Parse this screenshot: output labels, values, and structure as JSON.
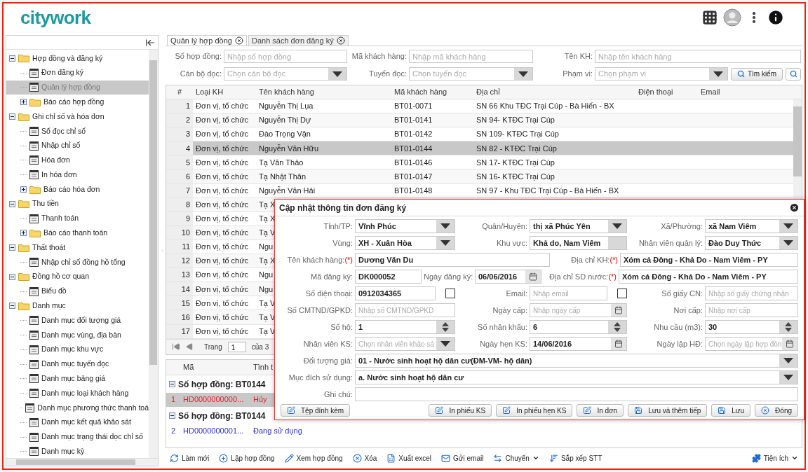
{
  "header": {
    "logo": "citywork"
  },
  "sidebar": {
    "items": [
      {
        "label": "Hợp đồng và đăng ký",
        "kind": "folder",
        "expanded": true,
        "selected": false,
        "children": [
          {
            "label": "Đơn đăng ký",
            "kind": "page",
            "selected": false
          },
          {
            "label": "Quản lý hợp đồng",
            "kind": "page",
            "selected": true
          },
          {
            "label": "Báo cáo hợp đồng",
            "kind": "folder",
            "expanded": false,
            "selected": false
          }
        ]
      },
      {
        "label": "Ghi chỉ số và hóa đơn",
        "kind": "folder",
        "expanded": true,
        "selected": false,
        "children": [
          {
            "label": "Sổ đọc chỉ số",
            "kind": "page",
            "selected": false
          },
          {
            "label": "Nhập chỉ số",
            "kind": "page",
            "selected": false
          },
          {
            "label": "Hóa đơn",
            "kind": "page",
            "selected": false
          },
          {
            "label": "In hóa đơn",
            "kind": "page",
            "selected": false
          },
          {
            "label": "Báo cáo hóa đơn",
            "kind": "folder",
            "expanded": false,
            "selected": false
          }
        ]
      },
      {
        "label": "Thu tiền",
        "kind": "folder",
        "expanded": true,
        "selected": false,
        "children": [
          {
            "label": "Thanh toán",
            "kind": "page",
            "selected": false
          },
          {
            "label": "Báo cáo thanh toán",
            "kind": "folder",
            "expanded": false,
            "selected": false
          }
        ]
      },
      {
        "label": "Thất thoát",
        "kind": "folder",
        "expanded": true,
        "selected": false,
        "children": [
          {
            "label": "Nhập chỉ số đồng hồ tổng",
            "kind": "page",
            "selected": false
          }
        ]
      },
      {
        "label": "Đồng hồ cơ quan",
        "kind": "folder",
        "expanded": true,
        "selected": false,
        "children": [
          {
            "label": "Biểu đồ",
            "kind": "page",
            "selected": false
          }
        ]
      },
      {
        "label": "Danh mục",
        "kind": "folder",
        "expanded": true,
        "selected": false,
        "children": [
          {
            "label": "Danh mục đối tượng giá",
            "kind": "page",
            "selected": false
          },
          {
            "label": "Danh mục vùng, địa bàn",
            "kind": "page",
            "selected": false
          },
          {
            "label": "Danh mục khu vực",
            "kind": "page",
            "selected": false
          },
          {
            "label": "Danh mục tuyến đọc",
            "kind": "page",
            "selected": false
          },
          {
            "label": "Danh mục bảng giá",
            "kind": "page",
            "selected": false
          },
          {
            "label": "Danh mục loại khách hàng",
            "kind": "page",
            "selected": false
          },
          {
            "label": "Danh mục phương thức thanh toá",
            "kind": "page",
            "selected": false
          },
          {
            "label": "Danh mục kết quả khảo sát",
            "kind": "page",
            "selected": false
          },
          {
            "label": "Danh mục trạng thái đọc chỉ số",
            "kind": "page",
            "selected": false
          },
          {
            "label": "Danh mục kỳ",
            "kind": "page",
            "selected": false
          }
        ]
      }
    ]
  },
  "tabs": [
    {
      "label": "Quản lý hợp đồng",
      "selected": true
    },
    {
      "label": "Danh sách đơn đăng ký",
      "selected": false
    }
  ],
  "filters": [
    {
      "label": "Số hợp đồng:",
      "placeholder": "Nhập số hợp đồng",
      "kind": "text"
    },
    {
      "label": "Mã khách hàng:",
      "placeholder": "Nhập mã khách hàng",
      "kind": "text"
    },
    {
      "label": "Tên KH:",
      "placeholder": "Nhập tên khách hàng",
      "kind": "text"
    },
    {
      "label": "Cán bộ đọc:",
      "placeholder": "Chọn cán bộ đọc",
      "kind": "select"
    },
    {
      "label": "Tuyến đọc:",
      "placeholder": "Chọn tuyến đọc",
      "kind": "select"
    },
    {
      "label": "Phạm vi:",
      "placeholder": "Chọn phạm vi",
      "kind": "select"
    }
  ],
  "search_button": "Tìm kiếm",
  "table": {
    "columns": [
      "#",
      "Loại KH",
      "Tên khách hàng",
      "Mã khách hàng",
      "Địa chỉ",
      "Điện thoại",
      "Email"
    ],
    "rows": [
      {
        "cells": [
          "1",
          "Đơn vị, tổ chức",
          "Nguyễn Thị Lụa",
          "BT01-0071",
          "SN 66 Khu TĐC Trại Cúp - Bà Hiến - BX"
        ],
        "selected": false
      },
      {
        "cells": [
          "2",
          "Đơn vị, tổ chức",
          "Nguyễn Thị Dự",
          "BT01-0141",
          "SN 94- KTĐC Trại Cúp"
        ],
        "selected": false
      },
      {
        "cells": [
          "3",
          "Đơn vị, tổ chức",
          "Đào Trọng Vận",
          "BT01-0142",
          "SN 109- KTĐC Trại Cúp"
        ],
        "selected": false
      },
      {
        "cells": [
          "4",
          "Đơn vị, tổ chức",
          "Nguyễn Văn Hữu",
          "BT01-0144",
          "SN 82 - KTĐC Trại Cúp"
        ],
        "selected": true
      },
      {
        "cells": [
          "5",
          "Đơn vị, tổ chức",
          "Tạ Văn Thảo",
          "BT01-0146",
          "SN 17- KTĐC Trại Cúp"
        ],
        "selected": false
      },
      {
        "cells": [
          "6",
          "Đơn vị, tổ chức",
          "Tạ Nhật Thân",
          "BT01-0147",
          "SN 16- KTĐC Trại Cúp"
        ],
        "selected": false
      },
      {
        "cells": [
          "7",
          "Đơn vị, tổ chức",
          "Nguyễn Văn Hải",
          "BT01-0148",
          "SN 97 - Khu TĐC Trại Cúp - Bà Hiến - BX"
        ],
        "selected": false
      },
      {
        "cells": [
          "8",
          "Đơn vị, tổ chức",
          "Tạ X"
        ],
        "selected": false
      },
      {
        "cells": [
          "9",
          "Đơn vị, tổ chức",
          "Tạ X"
        ],
        "selected": false
      },
      {
        "cells": [
          "10",
          "Đơn vị, tổ chức",
          "Tạ V"
        ],
        "selected": false
      },
      {
        "cells": [
          "11",
          "Đơn vị, tổ chức",
          "Ngu"
        ],
        "selected": false
      },
      {
        "cells": [
          "12",
          "Đơn vị, tổ chức",
          "Tạ X"
        ],
        "selected": false
      },
      {
        "cells": [
          "13",
          "Đơn vị, tổ chức",
          "Ngu"
        ],
        "selected": false
      },
      {
        "cells": [
          "14",
          "Đơn vị, tổ chức",
          "Ngu"
        ],
        "selected": false
      },
      {
        "cells": [
          "15",
          "Đơn vị, tổ chức",
          "Tạ V"
        ],
        "selected": false
      },
      {
        "cells": [
          "16",
          "Đơn vị, tổ chức",
          "Tạ V"
        ],
        "selected": false
      },
      {
        "cells": [
          "17",
          "Đơn vị, tổ chức",
          "Tạ V"
        ],
        "selected": false
      }
    ]
  },
  "pager": {
    "label": "Trang",
    "page": "1",
    "total": "của 3"
  },
  "contracts": {
    "columns": [
      "Mã",
      "Tình t"
    ],
    "groups": [
      {
        "title": "Số hợp đồng: BT0144",
        "rows": [
          {
            "index": "1",
            "code": "HD0000000000...",
            "status": "Hủy",
            "color": "#e8202a",
            "selected": true
          }
        ]
      },
      {
        "title": "Số hợp đồng: BT0144",
        "rows": [
          {
            "index": "2",
            "code": "HD0000000001...",
            "status": "Đang sử dụng",
            "color": "#2a2ad6",
            "selected": false
          }
        ]
      }
    ]
  },
  "toolbar": [
    {
      "label": "Làm mới",
      "kind": "refresh"
    },
    {
      "label": "Lập hợp đồng",
      "kind": "plus"
    },
    {
      "label": "Xem hợp đồng",
      "kind": "pencil"
    },
    {
      "label": "Xóa",
      "kind": "delete"
    },
    {
      "label": "Xuất excel",
      "kind": "excel"
    },
    {
      "label": "Gửi email",
      "kind": "mail"
    },
    {
      "label": "Chuyển",
      "kind": "swap",
      "dropdown": true
    },
    {
      "label": "Sắp xếp STT",
      "kind": "sort",
      "dropdown": false
    }
  ],
  "toolbar_right": {
    "label": "Tiện ích",
    "kind": "puzzle",
    "dropdown": true
  },
  "dialog": {
    "title": "Cập nhật thông tin đơn đăng ký",
    "rows": [
      {
        "kind": "three",
        "fields": [
          {
            "label": "Tỉnh/TP:",
            "kind": "select",
            "value": "Vĩnh Phúc"
          },
          {
            "label": "Quận/Huyện:",
            "kind": "select",
            "value": "thị xã Phúc Yên"
          },
          {
            "label": "Xã/Phường:",
            "kind": "select",
            "value": "xã Nam Viêm"
          }
        ]
      },
      {
        "kind": "three",
        "fields": [
          {
            "label": "Vùng:",
            "kind": "select",
            "value": "XH - Xuân Hòa"
          },
          {
            "label": "Khu vực:",
            "kind": "addon",
            "value": "Khả do, Nam Viêm"
          },
          {
            "label": "Nhân viên quản lý:",
            "kind": "select",
            "value": "Đào Duy Thức"
          }
        ]
      },
      {
        "kind": "two",
        "fields": [
          {
            "label": "Tên khách hàng:",
            "required_mark": "(*)",
            "kind": "text",
            "value": "Dương Văn Du"
          },
          {
            "label": "Địa chỉ KH:",
            "required_mark": "(*)",
            "kind": "text",
            "value": "Xóm cả Đông - Khả Do - Nam Viêm - PY"
          }
        ]
      },
      {
        "kind": "mixed",
        "fields": [
          {
            "label": "Mã đăng ký:",
            "kind": "text",
            "value": "DK000052"
          },
          {
            "label": "Ngày đăng ký:",
            "kind": "date",
            "value": "06/06/2016"
          },
          {
            "label": "Địa chỉ SD nước:",
            "required_mark": "(*)",
            "kind": "text",
            "value": "Xóm cả Đông - Khả Do - Nam Viêm - PY"
          }
        ]
      },
      {
        "kind": "three",
        "fields": [
          {
            "label": "Số điện thoại:",
            "kind": "check",
            "value": "0912034365",
            "checked": false
          },
          {
            "label": "Email:",
            "kind": "check",
            "placeholder": "Nhập email",
            "checked": false
          },
          {
            "label": "Số giấy CN:",
            "kind": "text",
            "placeholder": "Nhập số giấy chứng nhận"
          }
        ]
      },
      {
        "kind": "three",
        "fields": [
          {
            "label": "Số CMTND/GPKD:",
            "kind": "text",
            "placeholder": "Nhập số CMTND/GPKD"
          },
          {
            "label": "Ngày cấp:",
            "kind": "date",
            "placeholder": "Nhập ngày cấp"
          },
          {
            "label": "Nơi cấp:",
            "kind": "text",
            "placeholder": "Nhập nơi cấp"
          }
        ]
      },
      {
        "kind": "three",
        "fields": [
          {
            "label": "Số hộ:",
            "kind": "spin",
            "value": "1"
          },
          {
            "label": "Số nhân khẩu:",
            "kind": "spin",
            "value": "6"
          },
          {
            "label": "Nhu cầu (m3):",
            "kind": "spin",
            "value": "30"
          }
        ]
      },
      {
        "kind": "three",
        "fields": [
          {
            "label": "Nhân viên KS:",
            "kind": "select",
            "placeholder": "Chọn nhân viên khảo sá"
          },
          {
            "label": "Ngày hẹn KS:",
            "kind": "date",
            "value": "14/06/2016"
          },
          {
            "label": "Ngày lập HĐ:",
            "kind": "date",
            "placeholder": "Chọn ngày lập hợp đồn"
          }
        ]
      },
      {
        "kind": "full",
        "fields": [
          {
            "label": "Đối tượng giá:",
            "kind": "select",
            "value": "01 - Nước sinh hoạt hộ dân cư(ĐM-VM- hộ dân)"
          }
        ]
      },
      {
        "kind": "full",
        "fields": [
          {
            "label": "Mục đích sử dụng:",
            "kind": "select",
            "value": "a. Nước sinh hoạt hộ dân cư"
          }
        ]
      },
      {
        "kind": "full",
        "fields": [
          {
            "label": "Ghi chú:",
            "kind": "text"
          }
        ]
      }
    ],
    "left_button": {
      "label": "Tệp đính kèm",
      "kind": "edit"
    },
    "buttons": [
      {
        "label": "In phiếu KS",
        "kind": "edit"
      },
      {
        "label": "In phiếu hẹn KS",
        "kind": "edit"
      },
      {
        "label": "In đơn",
        "kind": "edit"
      },
      {
        "label": "Lưu và thêm tiếp",
        "kind": "save"
      },
      {
        "label": "Lưu",
        "kind": "save"
      },
      {
        "label": "Đóng",
        "kind": "close"
      }
    ]
  }
}
